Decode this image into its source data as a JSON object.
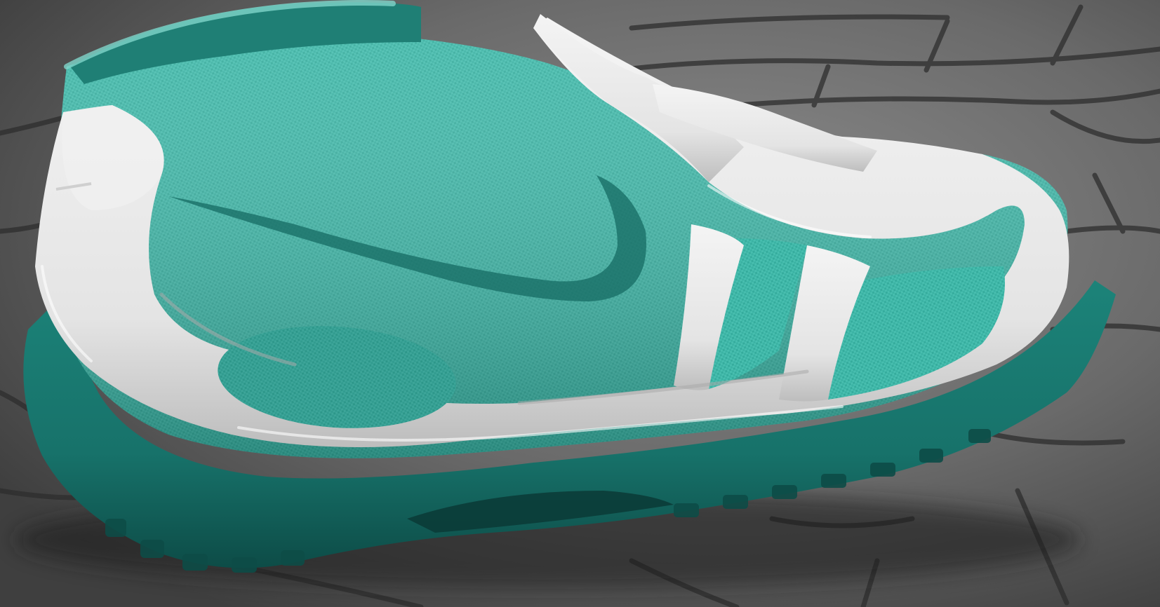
{
  "scene": {
    "subject": "shoe-render",
    "background": "cobblestone-floor",
    "colors": {
      "floor_light": "#8c8c8c",
      "floor_dark": "#3f3f3f",
      "floor_joint": "#2e2e2e",
      "fabric": "#3bb3a4",
      "fabric_light": "#52c7b8",
      "fabric_dark": "#1f7f75",
      "cage": "#e9e9e9",
      "cage_shadow": "#b9b9b9",
      "sole": "#17726a",
      "sole_dark": "#0d4c47",
      "swoosh": "#166b63"
    }
  }
}
